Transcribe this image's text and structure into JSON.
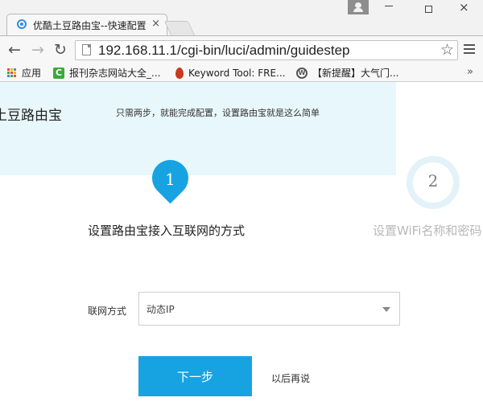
{
  "browser": {
    "tab_title": "优酷土豆路由宝--快速配置",
    "tab_close": "×",
    "window_controls": {
      "close": "×"
    },
    "url": "192.168.11.1/cgi-bin/luci/admin/guidestep",
    "nav": {
      "back": "←",
      "forward": "→",
      "reload": "↻",
      "star": "☆"
    },
    "bookmarks": [
      {
        "label": "应用",
        "icon": "apps-grid-icon"
      },
      {
        "label": "报刊杂志网站大全_...",
        "icon": "green-c-icon",
        "icon_text": "C"
      },
      {
        "label": "Keyword Tool: FRE...",
        "icon": "flame-icon"
      },
      {
        "label": "【新提醒】大气门...",
        "icon": "wordpress-icon",
        "icon_text": "W"
      }
    ],
    "bookmarks_overflow": "»"
  },
  "page": {
    "brand": "土豆路由宝",
    "tagline": "只需两步，就能完成配置，设置路由宝就是这么简单",
    "steps": [
      {
        "number": "1",
        "label": "设置路由宝接入互联网的方式",
        "active": true
      },
      {
        "number": "2",
        "label": "设置WiFi名称和密码",
        "active": false
      }
    ],
    "form": {
      "connection_label": "联网方式",
      "connection_value": "动态IP"
    },
    "next_button": "下一步",
    "later_link": "以后再说"
  },
  "colors": {
    "accent": "#17a3e2",
    "hero_background": "#e8f7fb",
    "inactive_step_text": "#b8b8b8"
  }
}
